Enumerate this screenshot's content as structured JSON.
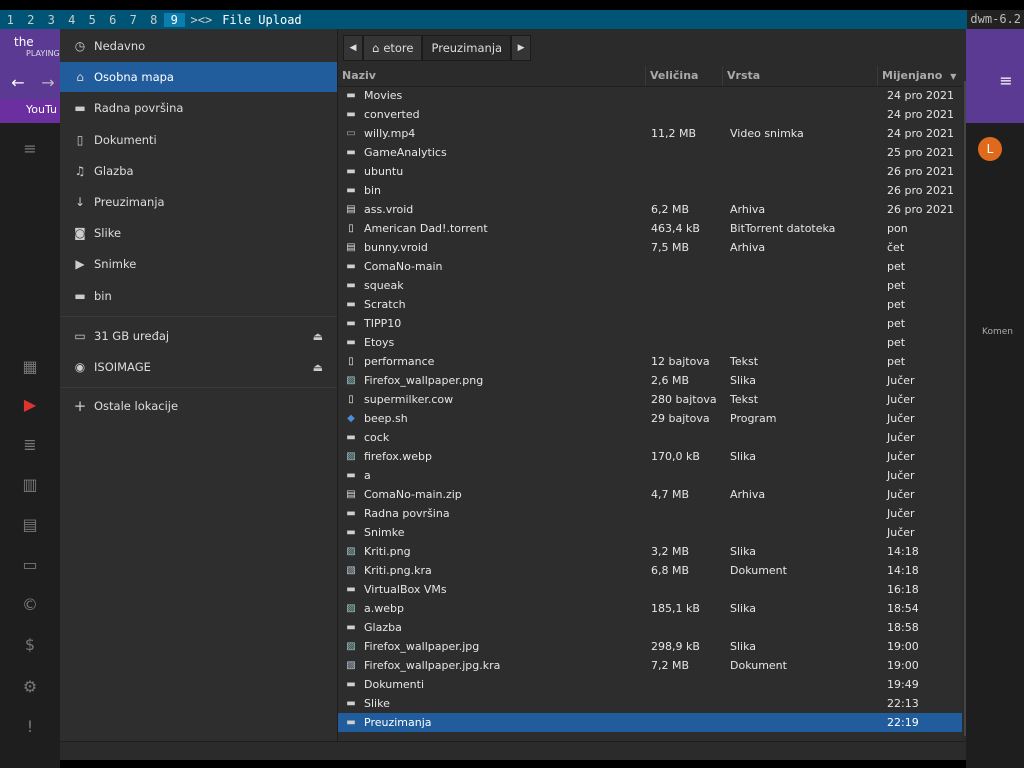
{
  "topbar": {
    "tags": [
      "1",
      "2",
      "3",
      "4",
      "5",
      "6",
      "7",
      "8",
      "9"
    ],
    "active_tag": "9",
    "layout_symbol": "><>",
    "window_title": "File Upload",
    "status": "dwm-6.2"
  },
  "background": {
    "left_title": "the",
    "left_subtitle": "PLAYING",
    "left_tab": "YouTu",
    "right_text": "Komen",
    "avatar_letter": "L"
  },
  "sidebar": {
    "items": [
      {
        "label": "Nedavno",
        "icon": "recent-icon"
      },
      {
        "label": "Osobna mapa",
        "icon": "home-icon"
      },
      {
        "label": "Radna površina",
        "icon": "folder-icon"
      },
      {
        "label": "Dokumenti",
        "icon": "document-icon"
      },
      {
        "label": "Glazba",
        "icon": "music-icon"
      },
      {
        "label": "Preuzimanja",
        "icon": "download-icon"
      },
      {
        "label": "Slike",
        "icon": "camera-icon"
      },
      {
        "label": "Snimke",
        "icon": "video-icon"
      },
      {
        "label": "bin",
        "icon": "folder-icon"
      }
    ],
    "devices": [
      {
        "label": "31 GB uređaj",
        "icon": "drive-icon"
      },
      {
        "label": "ISOIMAGE",
        "icon": "disc-icon"
      }
    ],
    "other_locations": "Ostale lokacije"
  },
  "pathbar": {
    "crumbs": [
      "etore",
      "Preuzimanja"
    ]
  },
  "columns": {
    "name": "Naziv",
    "size": "Veličina",
    "type": "Vrsta",
    "modified": "Mijenjano"
  },
  "files": [
    {
      "name": "Movies",
      "size": "",
      "type": "",
      "modified": "24 pro 2021",
      "kind": "folder"
    },
    {
      "name": "converted",
      "size": "",
      "type": "",
      "modified": "24 pro 2021",
      "kind": "folder"
    },
    {
      "name": "willy.mp4",
      "size": "11,2 MB",
      "type": "Video snimka",
      "modified": "24 pro 2021",
      "kind": "video"
    },
    {
      "name": "GameAnalytics",
      "size": "",
      "type": "",
      "modified": "25 pro 2021",
      "kind": "folder"
    },
    {
      "name": "ubuntu",
      "size": "",
      "type": "",
      "modified": "26 pro 2021",
      "kind": "folder"
    },
    {
      "name": "bin",
      "size": "",
      "type": "",
      "modified": "26 pro 2021",
      "kind": "folder"
    },
    {
      "name": "ass.vroid",
      "size": "6,2 MB",
      "type": "Arhiva",
      "modified": "26 pro 2021",
      "kind": "archive"
    },
    {
      "name": "American Dad!.torrent",
      "size": "463,4 kB",
      "type": "BitTorrent datoteka",
      "modified": "pon",
      "kind": "file"
    },
    {
      "name": "bunny.vroid",
      "size": "7,5 MB",
      "type": "Arhiva",
      "modified": "čet",
      "kind": "archive"
    },
    {
      "name": "ComaNo-main",
      "size": "",
      "type": "",
      "modified": "pet",
      "kind": "folder"
    },
    {
      "name": "squeak",
      "size": "",
      "type": "",
      "modified": "pet",
      "kind": "folder"
    },
    {
      "name": "Scratch",
      "size": "",
      "type": "",
      "modified": "pet",
      "kind": "folder"
    },
    {
      "name": "TIPP10",
      "size": "",
      "type": "",
      "modified": "pet",
      "kind": "folder"
    },
    {
      "name": "Etoys",
      "size": "",
      "type": "",
      "modified": "pet",
      "kind": "folder"
    },
    {
      "name": "performance",
      "size": "12 bajtova",
      "type": "Tekst",
      "modified": "pet",
      "kind": "file"
    },
    {
      "name": "Firefox_wallpaper.png",
      "size": "2,6 MB",
      "type": "Slika",
      "modified": "Jučer",
      "kind": "image"
    },
    {
      "name": "supermilker.cow",
      "size": "280 bajtova",
      "type": "Tekst",
      "modified": "Jučer",
      "kind": "file"
    },
    {
      "name": "beep.sh",
      "size": "29 bajtova",
      "type": "Program",
      "modified": "Jučer",
      "kind": "script"
    },
    {
      "name": "cock",
      "size": "",
      "type": "",
      "modified": "Jučer",
      "kind": "folder"
    },
    {
      "name": "firefox.webp",
      "size": "170,0 kB",
      "type": "Slika",
      "modified": "Jučer",
      "kind": "image"
    },
    {
      "name": "a",
      "size": "",
      "type": "",
      "modified": "Jučer",
      "kind": "folder"
    },
    {
      "name": "ComaNo-main.zip",
      "size": "4,7 MB",
      "type": "Arhiva",
      "modified": "Jučer",
      "kind": "archive"
    },
    {
      "name": "Radna površina",
      "size": "",
      "type": "",
      "modified": "Jučer",
      "kind": "folder"
    },
    {
      "name": "Snimke",
      "size": "",
      "type": "",
      "modified": "Jučer",
      "kind": "folder"
    },
    {
      "name": "Kriti.png",
      "size": "3,2 MB",
      "type": "Slika",
      "modified": "14:18",
      "kind": "image"
    },
    {
      "name": "Kriti.png.kra",
      "size": "6,8 MB",
      "type": "Dokument",
      "modified": "14:18",
      "kind": "document"
    },
    {
      "name": "VirtualBox VMs",
      "size": "",
      "type": "",
      "modified": "16:18",
      "kind": "folder"
    },
    {
      "name": "a.webp",
      "size": "185,1 kB",
      "type": "Slika",
      "modified": "18:54",
      "kind": "image"
    },
    {
      "name": "Glazba",
      "size": "",
      "type": "",
      "modified": "18:58",
      "kind": "folder"
    },
    {
      "name": "Firefox_wallpaper.jpg",
      "size": "298,9 kB",
      "type": "Slika",
      "modified": "19:00",
      "kind": "image"
    },
    {
      "name": "Firefox_wallpaper.jpg.kra",
      "size": "7,2 MB",
      "type": "Dokument",
      "modified": "19:00",
      "kind": "document"
    },
    {
      "name": "Dokumenti",
      "size": "",
      "type": "",
      "modified": "19:49",
      "kind": "folder"
    },
    {
      "name": "Slike",
      "size": "",
      "type": "",
      "modified": "22:13",
      "kind": "folder"
    },
    {
      "name": "Preuzimanja",
      "size": "",
      "type": "",
      "modified": "22:19",
      "kind": "folder"
    }
  ],
  "selected_file": "Preuzimanja"
}
